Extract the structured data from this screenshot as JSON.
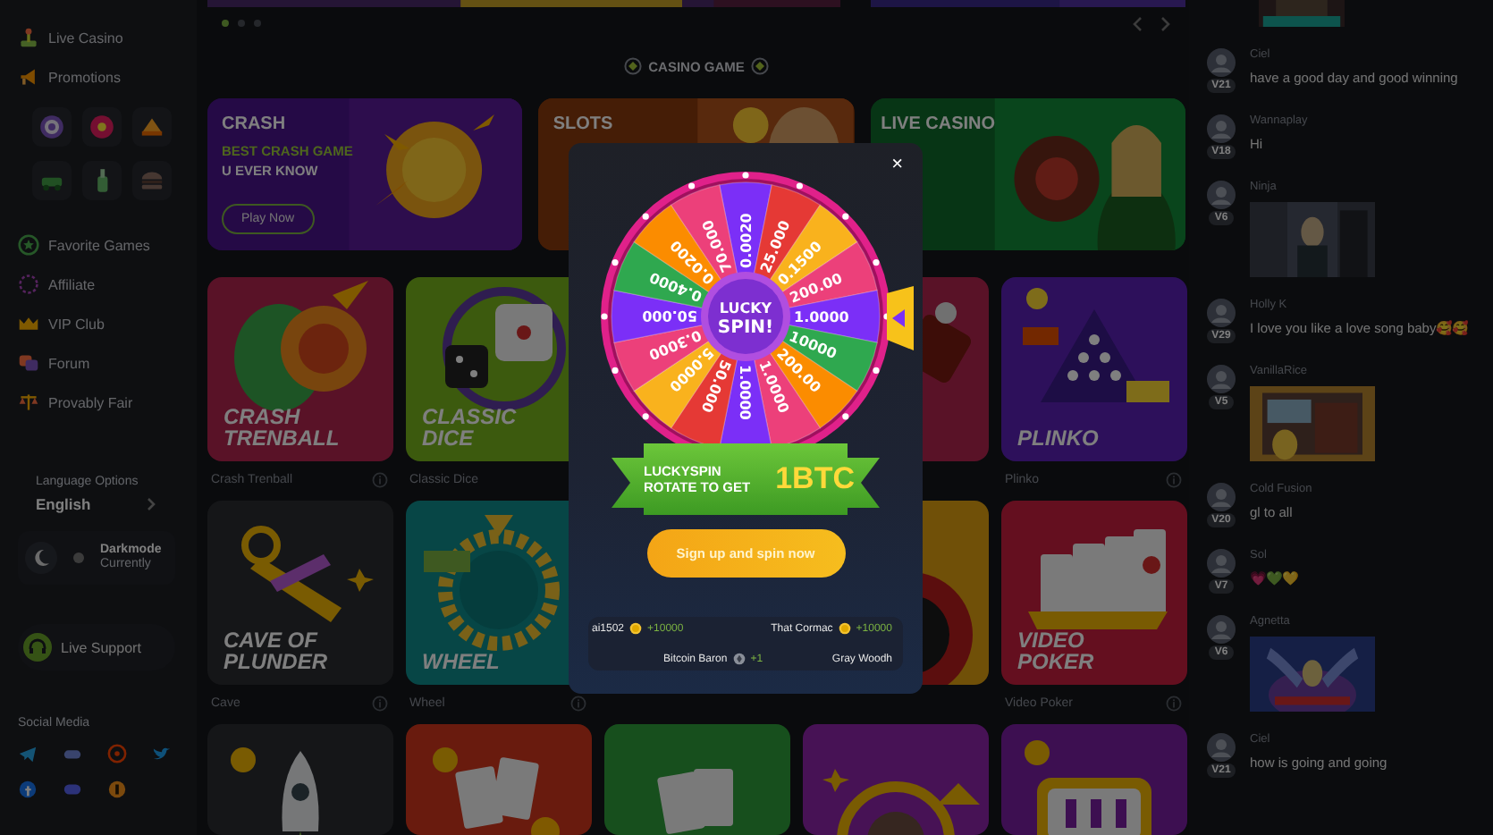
{
  "sidebar": {
    "top_items": [
      {
        "label": "Live Casino"
      },
      {
        "label": "Promotions"
      }
    ],
    "menu_items": [
      {
        "label": "Favorite Games"
      },
      {
        "label": "Affiliate"
      },
      {
        "label": "VIP Club"
      },
      {
        "label": "Forum"
      },
      {
        "label": "Provably Fair"
      }
    ],
    "language": {
      "label": "Language Options",
      "value": "English"
    },
    "theme": {
      "title": "Darkmode",
      "subtitle": "Currently"
    },
    "support": {
      "label": "Live Support"
    },
    "social": {
      "label": "Social Media"
    }
  },
  "main": {
    "carousel": {
      "dots": [
        {
          "selected": true
        },
        {
          "selected": false
        },
        {
          "selected": false
        }
      ]
    },
    "section_title": "CASINO GAME",
    "banners": [
      {
        "kind": "crash",
        "title": "CRASH",
        "lines": [
          {
            "text": "BEST CRASH GAME",
            "accent": true
          },
          {
            "text": "U EVER KNOW",
            "accent": false
          }
        ],
        "button": "Play Now"
      },
      {
        "kind": "slots",
        "title": "SLOTS"
      },
      {
        "kind": "live",
        "title": "LIVE CASINO"
      }
    ],
    "games": [
      {
        "kind": "trenball",
        "title": "CRASH TRENBALL",
        "caption": "Crash Trenball",
        "info": true
      },
      {
        "kind": "dice",
        "title": "CLASSIC DICE",
        "caption": "Classic Dice"
      },
      {
        "kind": "covered"
      },
      {
        "kind": "roulette-red"
      },
      {
        "kind": "plinko",
        "title": "PLINKO",
        "caption": "Plinko",
        "info": true
      },
      {
        "kind": "cave",
        "title": "CAVE OF PLUNDER",
        "caption": "Cave",
        "info": true
      },
      {
        "kind": "wheel",
        "title": "WHEEL",
        "caption": "Wheel",
        "info": true
      },
      {
        "kind": "covered"
      },
      {
        "kind": "roulette-orange"
      },
      {
        "kind": "poker",
        "title": "VIDEO POKER",
        "caption": "Video Poker",
        "info": true
      },
      {
        "kind": "rocket"
      },
      {
        "kind": "bingo"
      },
      {
        "kind": "blackjack"
      },
      {
        "kind": "hilo"
      },
      {
        "kind": "slots777"
      }
    ]
  },
  "chat": {
    "messages": [
      {
        "kind": "gif-top"
      },
      {
        "kind": "text",
        "name": "Ciel",
        "level": "V21",
        "text": "have a good day and good winning"
      },
      {
        "kind": "text",
        "name": "Wannaplay",
        "level": "V18",
        "text": "Hi"
      },
      {
        "kind": "gif",
        "name": "Ninja",
        "level": "V6"
      },
      {
        "kind": "text",
        "name": "Holly K",
        "level": "V29",
        "text": "I love you like a love song baby🥰🥰"
      },
      {
        "kind": "gif",
        "name": "VanillaRice",
        "level": "V5"
      },
      {
        "kind": "text",
        "name": "Cold Fusion",
        "level": "V20",
        "text": "gl to all"
      },
      {
        "kind": "text",
        "name": "Sol",
        "level": "V7",
        "text": "💗💚💛"
      },
      {
        "kind": "gif",
        "name": "Agnetta",
        "level": "V6"
      },
      {
        "kind": "text",
        "name": "Ciel",
        "level": "V21",
        "text": "how is going and going"
      }
    ]
  },
  "modal": {
    "close": "×",
    "wheel": {
      "center": [
        "LUCKY",
        "SPIN!"
      ],
      "segments": [
        {
          "value": "0.0020",
          "color": "#7b2ff7"
        },
        {
          "value": "25.000",
          "color": "#e53935"
        },
        {
          "value": "0.1500",
          "color": "#f9b21d"
        },
        {
          "value": "200.00",
          "color": "#ec407a"
        },
        {
          "value": "1.0000",
          "color": "#7b2ff7"
        },
        {
          "value": "10000",
          "color": "#2fa84f"
        },
        {
          "value": "200.00",
          "color": "#fb8c00"
        },
        {
          "value": "1.0000",
          "color": "#ec407a"
        },
        {
          "value": "1.0000",
          "color": "#7b2ff7"
        },
        {
          "value": "50.000",
          "color": "#e53935"
        },
        {
          "value": "5.0000",
          "color": "#f9b21d"
        },
        {
          "value": "0.3000",
          "color": "#ec407a"
        },
        {
          "value": "50.000",
          "color": "#7b2ff7"
        },
        {
          "value": "0.4000",
          "color": "#2fa84f"
        },
        {
          "value": "0.0200",
          "color": "#fb8c00"
        },
        {
          "value": "70.000",
          "color": "#ec407a"
        }
      ]
    },
    "ribbon": {
      "line1": "LUCKYSPIN",
      "line2": "ROTATE TO GET",
      "prize": "1BTC"
    },
    "button": "Sign up and spin now",
    "winner_rows": [
      [
        {
          "name": "ai1502",
          "amount": "+10000"
        },
        {
          "name": "That Cormac",
          "amount": "+10000"
        }
      ],
      [
        {
          "name": "Bitcoin Baron",
          "amount": "+1"
        },
        {
          "name": "Gray Woodh"
        }
      ]
    ]
  }
}
